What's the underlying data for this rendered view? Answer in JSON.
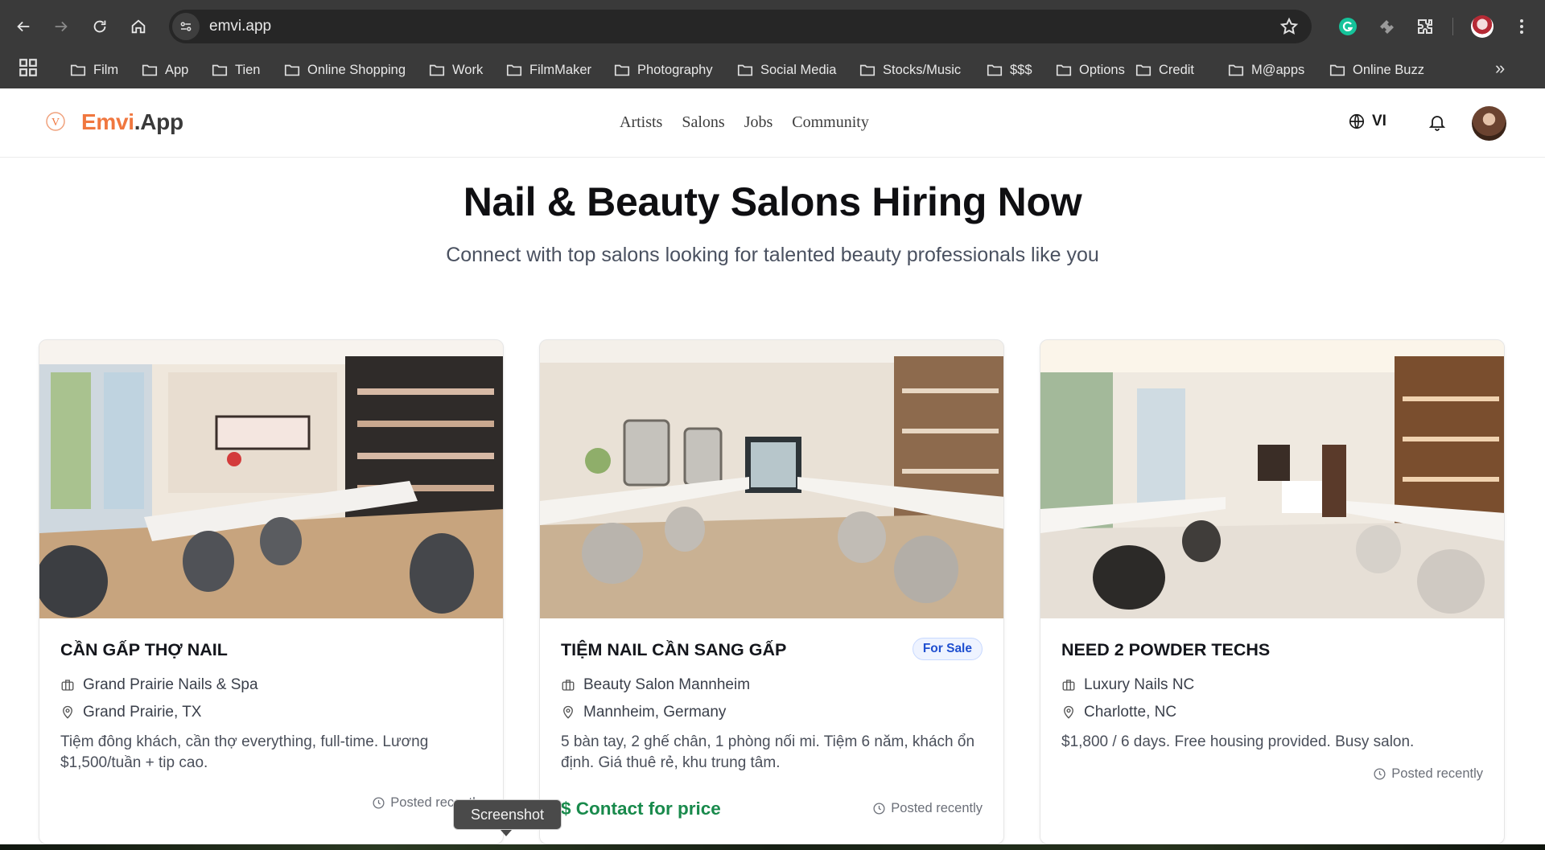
{
  "browser": {
    "url": "emvi.app",
    "bookmarks": [
      "Film",
      "App",
      "Tien",
      "Online Shopping",
      "Work",
      "FilmMaker",
      "Photography",
      "Social Media",
      "Stocks/Music",
      "$$$",
      "Options",
      "Credit",
      "M@apps",
      "Online Buzz"
    ],
    "more_symbol": "»"
  },
  "site": {
    "logo_part1": "Emvi",
    "logo_part2": ".App",
    "logo_glyph": "V",
    "nav": [
      "Artists",
      "Salons",
      "Jobs",
      "Community"
    ],
    "language": "VI"
  },
  "hero": {
    "title": "Nail & Beauty Salons Hiring Now",
    "subtitle": "Connect with top salons looking for talented beauty professionals like you"
  },
  "cards": [
    {
      "title": "CẦN GẤP THỢ NAIL",
      "salon": "Grand Prairie Nails & Spa",
      "location": "Grand Prairie, TX",
      "description": "Tiệm đông khách, cần thợ everything, full-time. Lương $1,500/tuần + tip cao.",
      "posted": "Posted recently"
    },
    {
      "title": "TIỆM NAIL CẦN SANG GẤP",
      "badge": "For Sale",
      "salon": "Beauty Salon Mannheim",
      "location": "Mannheim, Germany",
      "description": "5 bàn tay, 2 ghế chân, 1 phòng nối mi. Tiệm 6 năm, khách ổn định. Giá thuê rẻ, khu trung tâm.",
      "price": "$ Contact for price",
      "posted": "Posted recently"
    },
    {
      "title": "NEED 2 POWDER TECHS",
      "salon": "Luxury Nails NC",
      "location": "Charlotte, NC",
      "description": "$1,800 / 6 days. Free housing provided. Busy salon.",
      "posted": "Posted recently"
    }
  ],
  "tooltip": "Screenshot",
  "colors": {
    "brand_orange": "#f0773f",
    "badge_blue": "#1f4fd0",
    "price_green": "#198a4c"
  }
}
